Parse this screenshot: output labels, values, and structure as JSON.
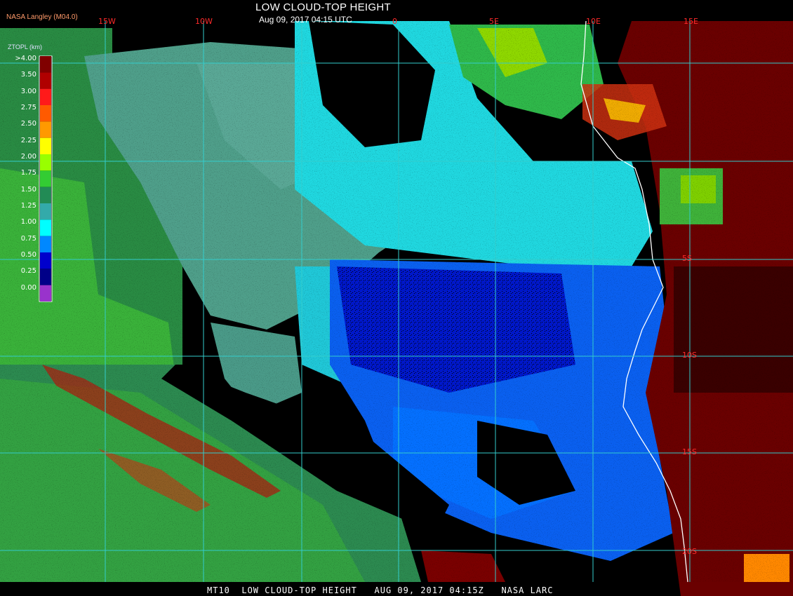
{
  "title": "LOW CLOUD-TOP HEIGHT",
  "subtitle": "Aug 09, 2017 04:15 UTC",
  "producer": "NASA Langley (M04.0)",
  "footer": "MT10  LOW CLOUD-TOP HEIGHT   AUG 09, 2017 04:15Z   NASA LARC",
  "legend": {
    "unit_label": "ZTOPL (km)",
    "ticks": [
      ">4.00",
      "3.50",
      "3.00",
      "2.75",
      "2.50",
      "2.25",
      "2.00",
      "1.75",
      "1.50",
      "1.25",
      "1.00",
      "0.75",
      "0.50",
      "0.25",
      "0.00"
    ],
    "colors": [
      "#800000",
      "#b00000",
      "#ff1a1a",
      "#ff5a00",
      "#ff9900",
      "#ffff00",
      "#99ff00",
      "#33cc33",
      "#228b55",
      "#33aaaa",
      "#00ffff",
      "#0088ff",
      "#0000cc",
      "#000088",
      "#9933cc"
    ]
  },
  "longitude_labels": [
    "15W",
    "10W",
    "0",
    "5E",
    "10E",
    "15E"
  ],
  "latitude_labels": [
    "5S",
    "10S",
    "15S",
    "20S"
  ],
  "colors": {
    "gridline": "#33cccc",
    "label_red": "#ff2a2a",
    "coast": "#ffffff"
  }
}
